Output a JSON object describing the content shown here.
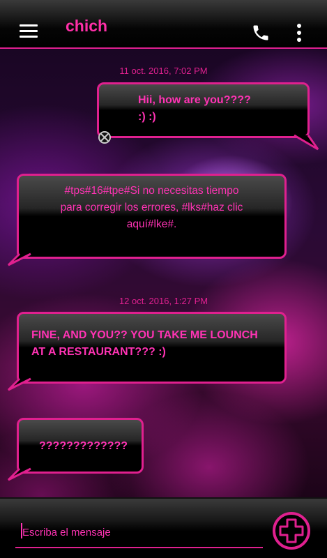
{
  "header": {
    "title": "chich",
    "icons": [
      "menu-icon",
      "phone-icon",
      "more-vert-icon"
    ]
  },
  "colors": {
    "accent": "#e0208f",
    "text_pink": "#ff33b4",
    "header_bg": "#000000"
  },
  "messages": [
    {
      "timestamp": "11 oct. 2016, 7:02 PM"
    },
    {
      "side": "sent",
      "lines": [
        "Hii, how are you????",
        ":)  :)"
      ]
    },
    {
      "side": "received",
      "lines": [
        "#tps#16#tpe#Si no necesitas tiempo",
        "para corregir los errores, #lks#haz clic",
        "aquí#lke#."
      ]
    },
    {
      "timestamp": "12 oct. 2016, 1:27 PM"
    },
    {
      "side": "received",
      "lines": [
        "FINE, AND YOU?? YOU TAKE ME LOUNCH",
        "AT A RESTAURANT???  :)"
      ]
    },
    {
      "side": "received",
      "lines": [
        "?????????????"
      ]
    }
  ],
  "composer": {
    "placeholder": "Escriba el mensaje",
    "add_icon": "add-circle-icon"
  }
}
